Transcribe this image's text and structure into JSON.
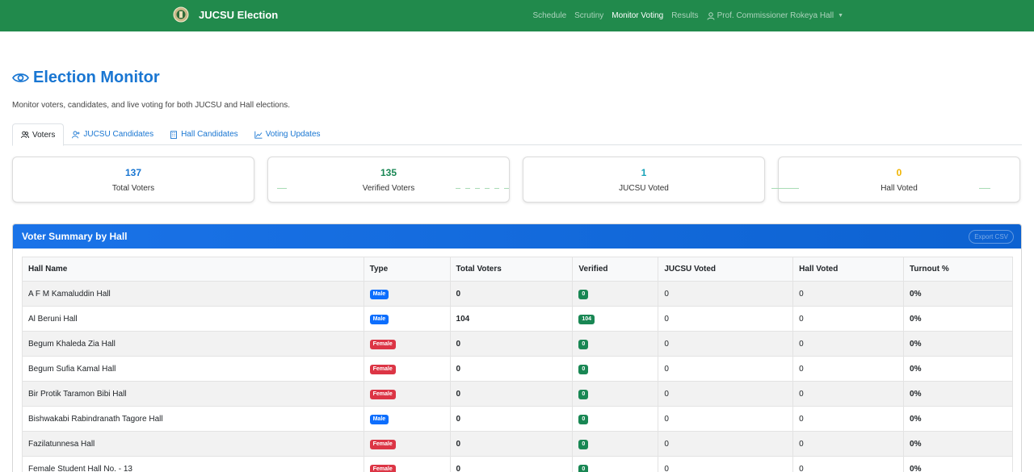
{
  "navbar": {
    "brand": "JUCSU Election",
    "links": [
      "Schedule",
      "Scrutiny",
      "Monitor Voting",
      "Results"
    ],
    "user": "Prof. Commissioner Rokeya Hall",
    "colors": {
      "background": "#218a4c",
      "active": "#ffffff"
    }
  },
  "page": {
    "title": "Election Monitor",
    "subtitle": "Monitor voters, candidates, and live voting for both JUCSU and Hall elections.",
    "accent_color": "#1976d2"
  },
  "tabs": [
    {
      "label": "Voters",
      "icon": "users-icon",
      "active": true
    },
    {
      "label": "JUCSU Candidates",
      "icon": "user-plus-icon",
      "active": false
    },
    {
      "label": "Hall Candidates",
      "icon": "building-icon",
      "active": false
    },
    {
      "label": "Voting Updates",
      "icon": "chart-line-icon",
      "active": false
    }
  ],
  "stats": [
    {
      "value": "137",
      "label": "Total Voters",
      "color": "#1976d2"
    },
    {
      "value": "135",
      "label": "Verified Voters",
      "color": "#198754"
    },
    {
      "value": "1",
      "label": "JUCSU Voted",
      "color": "#17a2b8"
    },
    {
      "value": "0",
      "label": "Hall Voted",
      "color": "#f0b400"
    }
  ],
  "summary": {
    "title": "Voter Summary by Hall",
    "export_label": "Export CSV",
    "columns": [
      "Hall Name",
      "Type",
      "Total Voters",
      "Verified",
      "JUCSU Voted",
      "Hall Voted",
      "Turnout %"
    ],
    "rows": [
      {
        "hall": "A F M Kamaluddin Hall",
        "type": "Male",
        "total": "0",
        "verified": "0",
        "jucsu": "0",
        "hall_voted": "0",
        "turnout": "0%"
      },
      {
        "hall": "Al Beruni Hall",
        "type": "Male",
        "total": "104",
        "verified": "104",
        "jucsu": "0",
        "hall_voted": "0",
        "turnout": "0%"
      },
      {
        "hall": "Begum Khaleda Zia Hall",
        "type": "Female",
        "total": "0",
        "verified": "0",
        "jucsu": "0",
        "hall_voted": "0",
        "turnout": "0%"
      },
      {
        "hall": "Begum Sufia Kamal Hall",
        "type": "Female",
        "total": "0",
        "verified": "0",
        "jucsu": "0",
        "hall_voted": "0",
        "turnout": "0%"
      },
      {
        "hall": "Bir Protik Taramon Bibi Hall",
        "type": "Female",
        "total": "0",
        "verified": "0",
        "jucsu": "0",
        "hall_voted": "0",
        "turnout": "0%"
      },
      {
        "hall": "Bishwakabi Rabindranath Tagore Hall",
        "type": "Male",
        "total": "0",
        "verified": "0",
        "jucsu": "0",
        "hall_voted": "0",
        "turnout": "0%"
      },
      {
        "hall": "Fazilatunnesa Hall",
        "type": "Female",
        "total": "0",
        "verified": "0",
        "jucsu": "0",
        "hall_voted": "0",
        "turnout": "0%"
      },
      {
        "hall": "Female Student Hall No. - 13",
        "type": "Female",
        "total": "0",
        "verified": "0",
        "jucsu": "0",
        "hall_voted": "0",
        "turnout": "0%"
      }
    ]
  }
}
